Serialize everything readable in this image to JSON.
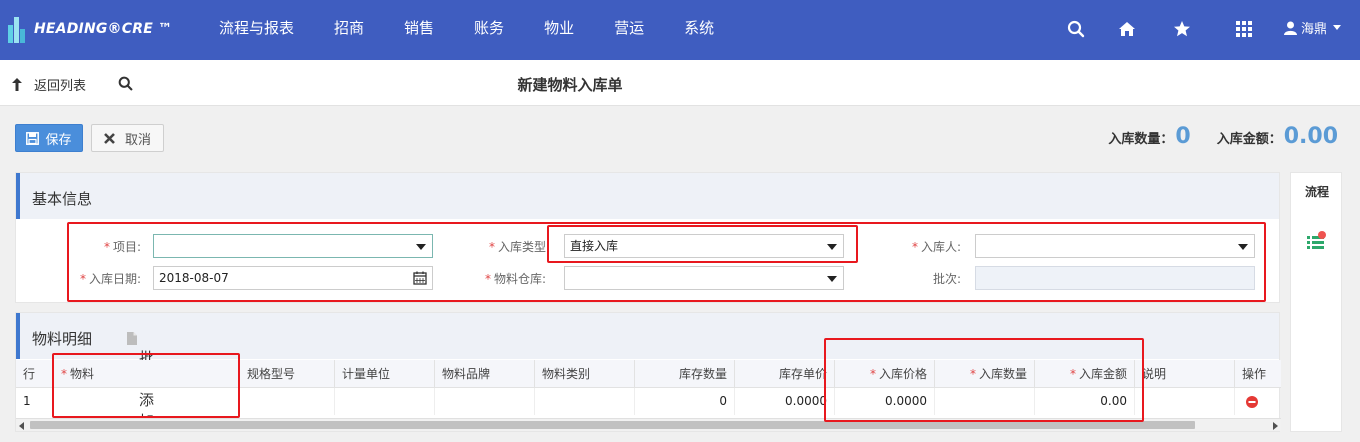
{
  "app": {
    "brand": "HEADING®CRE ™",
    "menu": [
      "流程与报表",
      "招商",
      "销售",
      "账务",
      "物业",
      "营运",
      "系统"
    ],
    "user_name": "海鼎"
  },
  "subbar": {
    "back_label": "返回列表",
    "page_title": "新建物料入库单"
  },
  "toolbar": {
    "save_label": "保存",
    "cancel_label": "取消"
  },
  "summary": {
    "qty_label": "入库数量：",
    "qty_value": "0",
    "amount_label": "入库金额：",
    "amount_value": "0.00"
  },
  "basic_info": {
    "title": "基本信息",
    "fields": {
      "project": {
        "label": "项目:",
        "value": ""
      },
      "type": {
        "label": "入库类型",
        "value": "直接入库"
      },
      "person": {
        "label": "入库人:",
        "value": ""
      },
      "date": {
        "label": "入库日期:",
        "value": "2018-08-07"
      },
      "warehouse": {
        "label": "物料仓库:",
        "value": ""
      },
      "batch": {
        "label": "批次:",
        "value": ""
      }
    }
  },
  "details": {
    "title": "物料明细",
    "batch_add_label": "批量添加",
    "columns": [
      "行",
      "物料",
      "规格型号",
      "计量单位",
      "物料品牌",
      "物料类别",
      "库存数量",
      "库存单价",
      "入库价格",
      "入库数量",
      "入库金额",
      "说明",
      "操作"
    ],
    "rows": [
      {
        "row": "1",
        "material": "",
        "spec": "",
        "unit": "",
        "brand": "",
        "category": "",
        "stock_qty": "0",
        "stock_price": "0.0000",
        "in_price": "0.0000",
        "in_qty": "",
        "in_amount": "0.00",
        "note": ""
      }
    ]
  },
  "side_panel": {
    "tab_label": "流程"
  },
  "colors": {
    "nav_bg": "#3f5dc0",
    "accent": "#4a8edb",
    "highlight_box": "#e8181e",
    "required": "#e04545",
    "delete": "#e53935"
  }
}
